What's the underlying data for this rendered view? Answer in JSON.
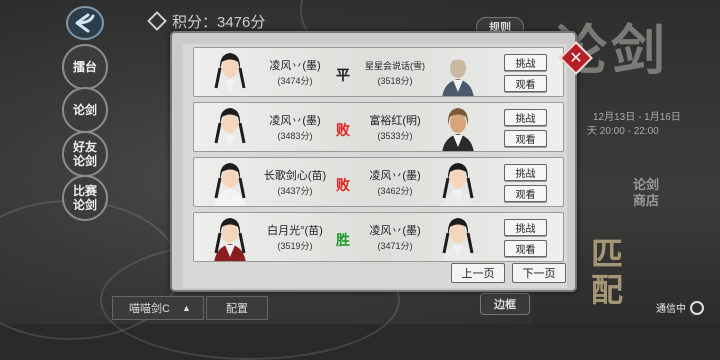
{
  "score": {
    "label": "积分：3476分"
  },
  "sidebar": {
    "items": [
      {
        "label": "擂台"
      },
      {
        "label": "论剑"
      },
      {
        "label": "好友论剑"
      },
      {
        "label": "比赛论剑"
      }
    ]
  },
  "right_panel": {
    "title": "论剑",
    "top_tab": "规则",
    "date": "12月13日 - 1月16日",
    "time": "天 20:00 - 22:00",
    "shop": "论剑商店",
    "match": "匹配",
    "frame_tab": "边框",
    "status": "通信中"
  },
  "bottom": {
    "dropdown_label": "喵喵剑C",
    "config_label": "配置"
  },
  "dialog": {
    "prev_label": "上一页",
    "next_label": "下一页",
    "challenge_label": "挑战",
    "watch_label": "观看",
    "records": [
      {
        "left_name": "凌风丷(墨)",
        "left_score": "(3474分)",
        "result": "平",
        "result_color": "#222222",
        "right_name": "星星会说话(雪)",
        "right_score": "(3518分)"
      },
      {
        "left_name": "凌风丷(墨)",
        "left_score": "(3483分)",
        "result": "败",
        "result_color": "#e0201e",
        "right_name": "富裕红(明)",
        "right_score": "(3533分)"
      },
      {
        "left_name": "长歌剑心(苗)",
        "left_score": "(3437分)",
        "result": "败",
        "result_color": "#e0201e",
        "right_name": "凌风丷(墨)",
        "right_score": "(3462分)"
      },
      {
        "left_name": "白月光°(苗)",
        "left_score": "(3519分)",
        "result": "胜",
        "result_color": "#1a9a2a",
        "right_name": "凌风丷(墨)",
        "right_score": "(3471分)"
      }
    ]
  }
}
